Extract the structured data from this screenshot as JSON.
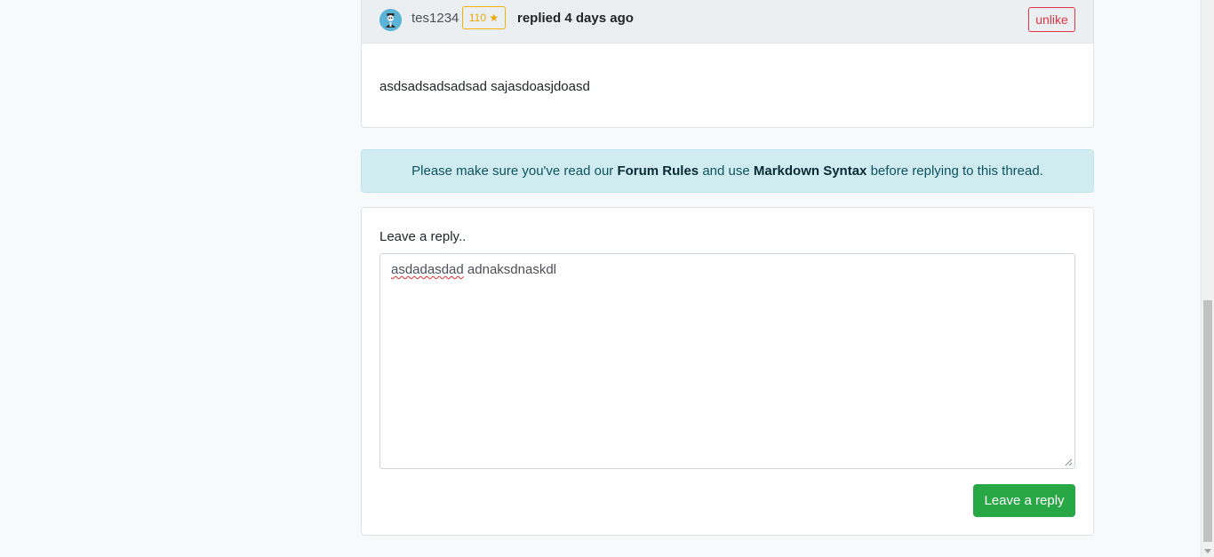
{
  "reply": {
    "username": "tes1234",
    "reputation": "110 ★",
    "replied_prefix": "replied",
    "replied_time": "4 days ago",
    "unlike_label": "unlike",
    "body": "asdsadsadsadsad sajasdoasjdoasd",
    "avatar_icon": "user-avatar-icon"
  },
  "alert": {
    "text_1": "Please make sure you've read our ",
    "link_rules": "Forum Rules",
    "text_2": " and use ",
    "link_markdown": "Markdown Syntax",
    "text_3": " before replying to this thread."
  },
  "form": {
    "label": "Leave a reply..",
    "textarea_word_1": "asdadasdad",
    "textarea_word_2": " adnaksdnaskdl",
    "submit_label": "Leave a reply"
  },
  "colors": {
    "success": "#28a745",
    "danger": "#dc3545",
    "warning": "#f0b400",
    "info_bg": "#d1ecf1"
  }
}
